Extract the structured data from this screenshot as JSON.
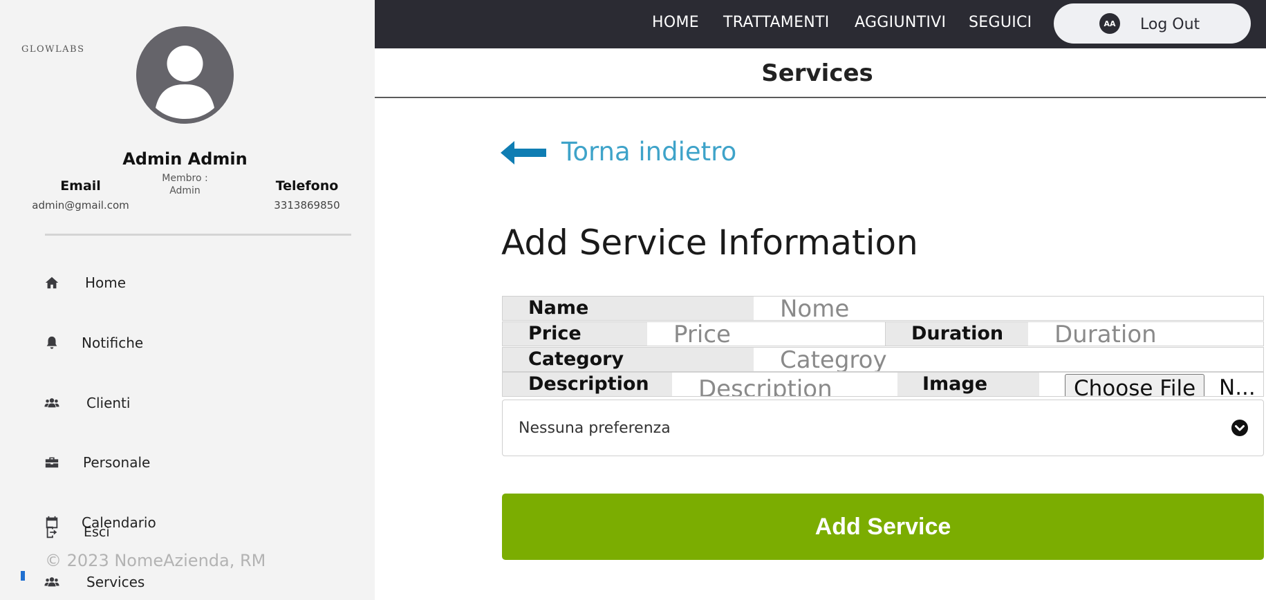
{
  "sidebar": {
    "logo": "GLOWLABS",
    "user_name": "Admin Admin",
    "email_title": "Email",
    "email_value": "admin@gmail.com",
    "member_line1": "Membro :",
    "member_line2": "Admin",
    "phone_title": "Telefono",
    "phone_value": "3313869850",
    "items": [
      {
        "label": "Home",
        "icon": "home-icon"
      },
      {
        "label": "Notifiche",
        "icon": "bell-icon"
      },
      {
        "label": "Clienti",
        "icon": "users-icon"
      },
      {
        "label": "Personale",
        "icon": "briefcase-icon"
      },
      {
        "label": "Calendario",
        "icon": "calendar-icon"
      },
      {
        "label": "Esci",
        "icon": "logout-icon"
      },
      {
        "label": "Services",
        "icon": "users-icon",
        "active": true
      }
    ],
    "copyright": "© 2023 NomeAzienda, RM"
  },
  "topbar": {
    "links": [
      "HOME",
      "TRATTAMENTI",
      "AGGIUNTIVI",
      "SEGUICI"
    ],
    "avatar_initials": "AA",
    "logout_label": "Log Out"
  },
  "page": {
    "title": "Services",
    "back_label": "Torna indietro",
    "form_title": "Add Service Information"
  },
  "form": {
    "name_label": "Name",
    "name_placeholder": "Nome",
    "price_label": "Price",
    "price_placeholder": "Price",
    "duration_label": "Duration",
    "duration_placeholder": "Duration",
    "category_label": "Category",
    "category_placeholder": "Categroy",
    "description_label": "Description",
    "description_placeholder": "Description",
    "image_label": "Image",
    "file_button": "Choose File",
    "file_name": "N...",
    "select_value": "Nessuna preferenza",
    "submit_label": "Add Service"
  },
  "colors": {
    "sidebar_bg": "#f3f3f3",
    "topbar_bg": "#2b2b33",
    "back_link": "#3ea3c9",
    "back_arrow": "#0f7db3",
    "submit_bg": "#7bad01",
    "active_marker": "#1f6fd0"
  }
}
